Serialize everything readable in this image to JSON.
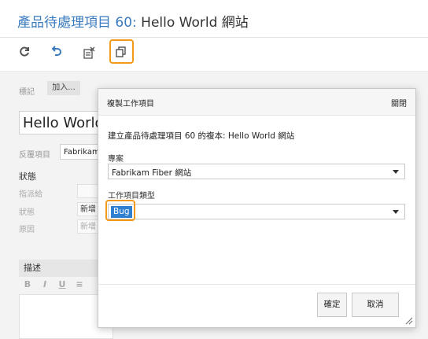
{
  "header": {
    "title_prefix": "產品待處理項目 60:",
    "title_rest": " Hello World 網站"
  },
  "toolbar": {
    "icons": [
      "refresh-icon",
      "undo-icon",
      "clear-icon",
      "copy-work-item-icon"
    ],
    "highlight_color": "#f39a1b"
  },
  "form": {
    "tags_label": "標記",
    "tags_add": "加入...",
    "title_value": "Hello World",
    "area_label": "反覆項目",
    "area_value": "Fabrikam",
    "state_heading": "狀態",
    "assigned_label": "指派給",
    "state_label": "狀態",
    "state_value": "新增",
    "reason_label": "原因",
    "reason_value": "新增",
    "description_heading": "描述",
    "editor_buttons": [
      "B",
      "I",
      "U"
    ]
  },
  "dialog": {
    "title": "複製工作項目",
    "close_label": "關閉",
    "description": "建立產品待處理項目 60 的複本: Hello World 網站",
    "project_label": "專案",
    "project_value": "Fabrikam Fiber 網站",
    "type_label": "工作項目類型",
    "type_value": "Bug",
    "ok_label": "確定",
    "cancel_label": "取消"
  },
  "colors": {
    "title_link": "#3a7bbf",
    "selection": "#2f7fd0",
    "highlight": "#f39a1b"
  }
}
